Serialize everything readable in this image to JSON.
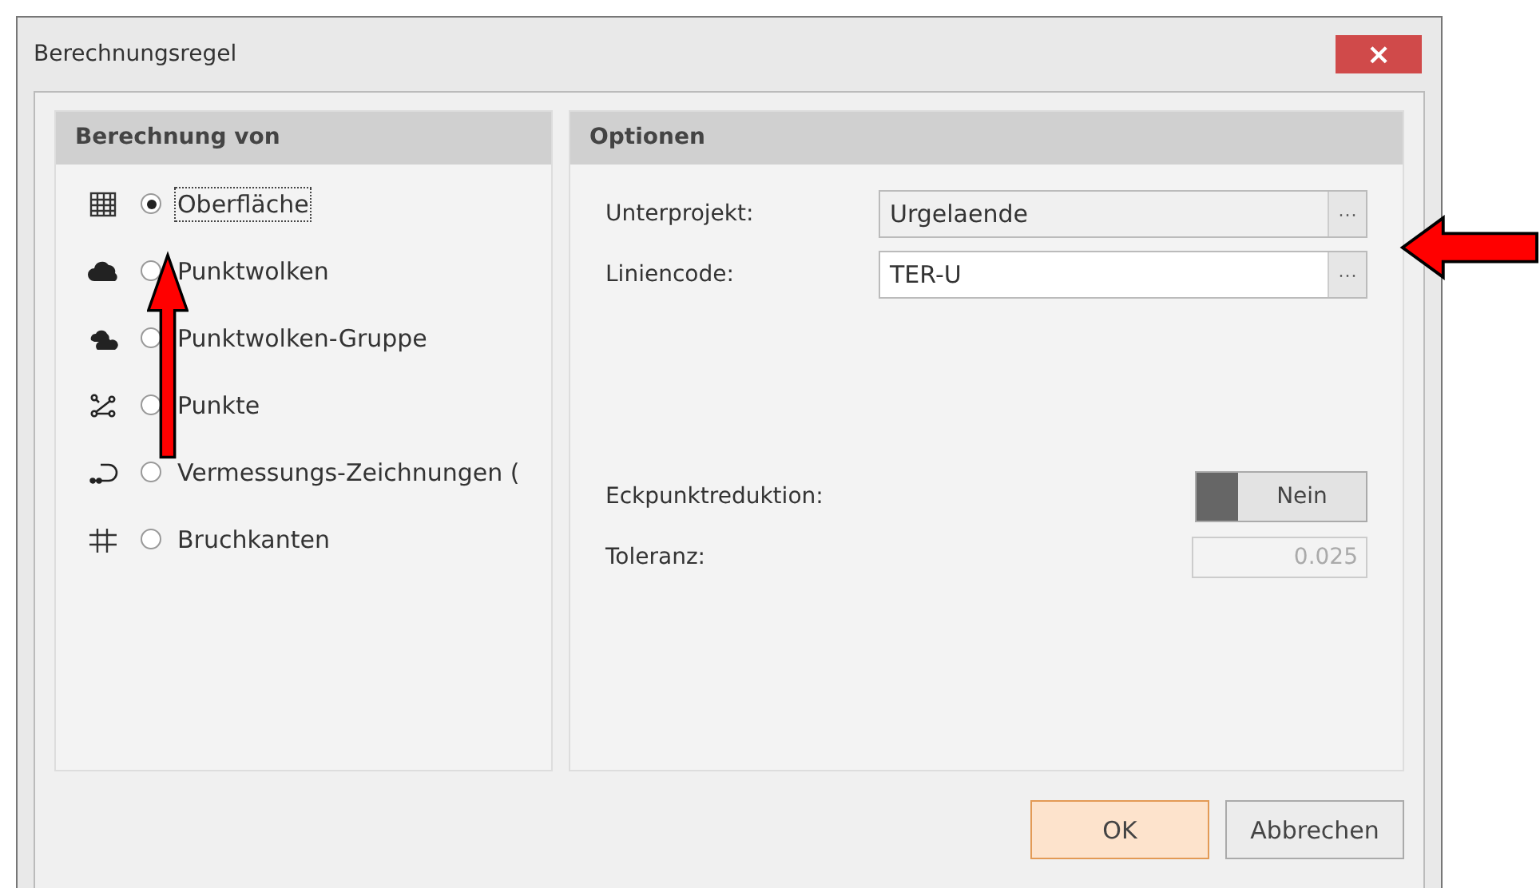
{
  "window": {
    "title": "Berechnungsregel"
  },
  "left_panel": {
    "title": "Berechnung von",
    "items": [
      {
        "kind": "grid",
        "label": "Oberfläche",
        "selected": true
      },
      {
        "kind": "cloud",
        "label": "Punktwolken",
        "selected": false
      },
      {
        "kind": "clouds",
        "label": "Punktwolken-Gruppe",
        "selected": false
      },
      {
        "kind": "points",
        "label": "Punkte",
        "selected": false
      },
      {
        "kind": "survey",
        "label": "Vermessungs-Zeichnungen (",
        "selected": false
      },
      {
        "kind": "breaklines",
        "label": "Bruchkanten",
        "selected": false
      }
    ]
  },
  "right_panel": {
    "title": "Optionen",
    "fields": [
      {
        "label": "Unterprojekt:",
        "value": "Urgelaende",
        "disabled": true,
        "browse": "···"
      },
      {
        "label": "Liniencode:",
        "value": "TER-U",
        "disabled": false,
        "browse": "···"
      }
    ],
    "corner_reduction": {
      "label": "Eckpunktreduktion:",
      "toggle": "Nein",
      "on": false
    },
    "tolerance": {
      "label": "Toleranz:",
      "value": "0.025",
      "disabled": true
    }
  },
  "buttons": [
    {
      "label": "OK",
      "default": true
    },
    {
      "label": "Abbrechen",
      "default": false
    }
  ],
  "close": "×"
}
